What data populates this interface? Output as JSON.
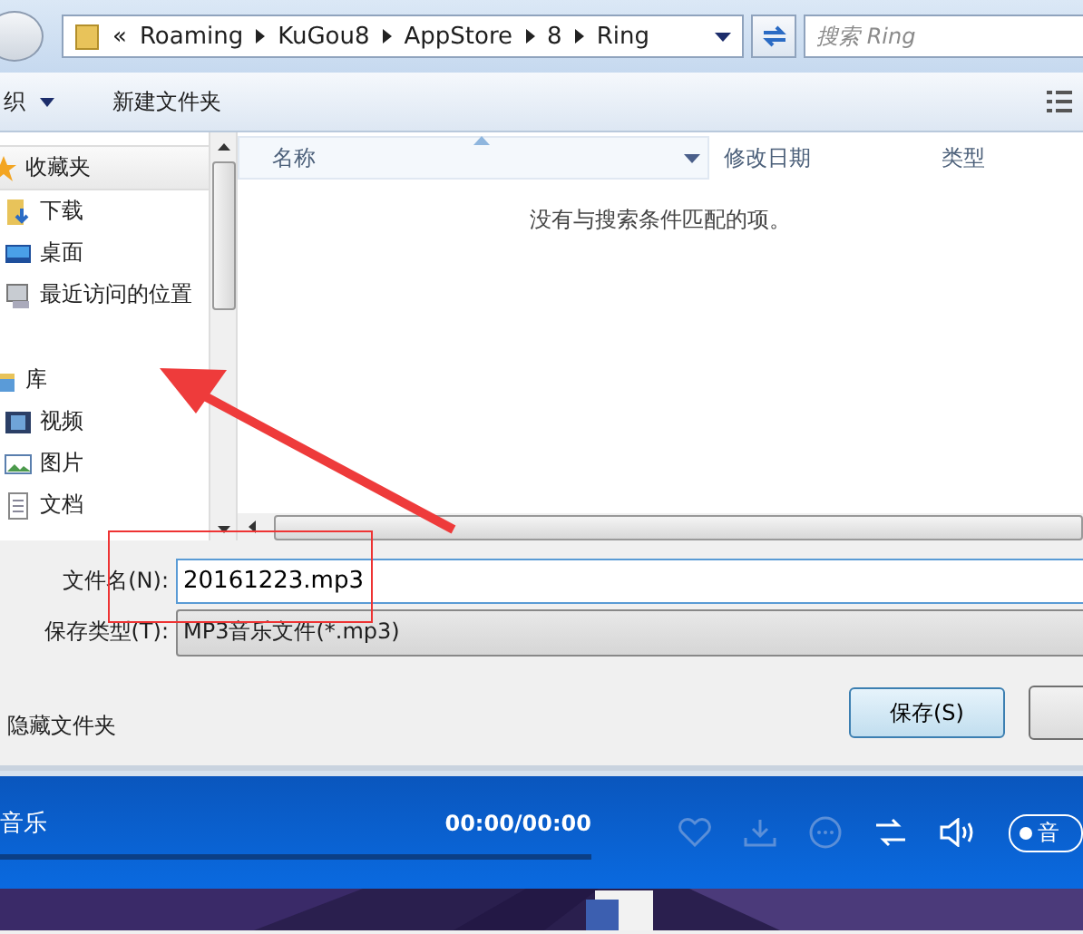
{
  "address_bar": {
    "overflow": "«",
    "path": [
      "Roaming",
      "KuGou8",
      "AppStore",
      "8",
      "Ring"
    ],
    "search": {
      "placeholder": "搜索 Ring"
    }
  },
  "toolbar": [
    {
      "label": "织",
      "dropdown": true
    },
    {
      "label": "新建文件夹",
      "dropdown": false
    }
  ],
  "sidebar": {
    "groups": [
      {
        "label": "收藏夹",
        "kind": "star",
        "children": [
          {
            "label": "下载",
            "kind": "download"
          },
          {
            "label": "桌面",
            "kind": "desktop"
          },
          {
            "label": "最近访问的位置",
            "kind": "recent"
          }
        ]
      },
      {
        "label": "库",
        "kind": "library",
        "children": [
          {
            "label": "视频",
            "kind": "video"
          },
          {
            "label": "图片",
            "kind": "picture"
          },
          {
            "label": "文档",
            "kind": "document"
          }
        ]
      }
    ]
  },
  "columns": [
    {
      "label": "名称",
      "sorted": true
    },
    {
      "label": "修改日期",
      "sorted": false
    },
    {
      "label": "类型",
      "sorted": false
    }
  ],
  "empty_message": "没有与搜索条件匹配的项。",
  "file_name": {
    "label": "文件名(N):",
    "value": "20161223.mp3"
  },
  "file_type": {
    "label": "保存类型(T):",
    "value": "MP3音乐文件(*.mp3)"
  },
  "hide_folders": "隐藏文件夹",
  "buttons": [
    "保存(S)"
  ],
  "player": {
    "title": "音乐",
    "time": "00:00/00:00",
    "level": 0,
    "pill": "音"
  }
}
